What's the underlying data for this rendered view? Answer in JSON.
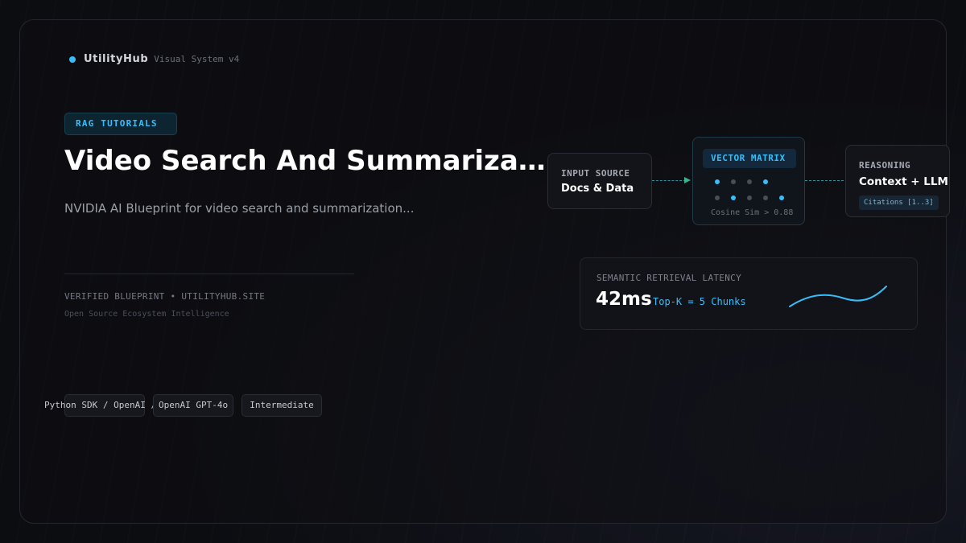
{
  "brand": {
    "name": "UtilityHub",
    "subtitle": "Visual System v4",
    "accent": "#38bdf8"
  },
  "hero": {
    "badge": "RAG TUTORIALS",
    "title": "Video Search And Summarizat...",
    "subtitle": "NVIDIA AI Blueprint for video search and summarization..."
  },
  "footer": {
    "verified": "VERIFIED BLUEPRINT • UTILITYHUB.SITE",
    "ecosystem": "Open Source Ecosystem Intelligence"
  },
  "tags": [
    "Python SDK / OpenAI /",
    "OpenAI GPT-4o",
    "Intermediate"
  ],
  "pipeline": {
    "input": {
      "label": "INPUT SOURCE",
      "value": "Docs & Data"
    },
    "vector": {
      "label": "VECTOR MATRIX",
      "similarity": "Cosine Sim > 0.88",
      "dots": [
        [
          true,
          false,
          false,
          true
        ],
        [
          false,
          true,
          false,
          false,
          true
        ]
      ]
    },
    "reasoning": {
      "label": "REASONING",
      "value": "Context + LLM",
      "citations": "Citations [1..3]"
    }
  },
  "latency": {
    "label": "SEMANTIC RETRIEVAL LATENCY",
    "value": "42ms",
    "topk": "Top-K = 5 Chunks"
  }
}
